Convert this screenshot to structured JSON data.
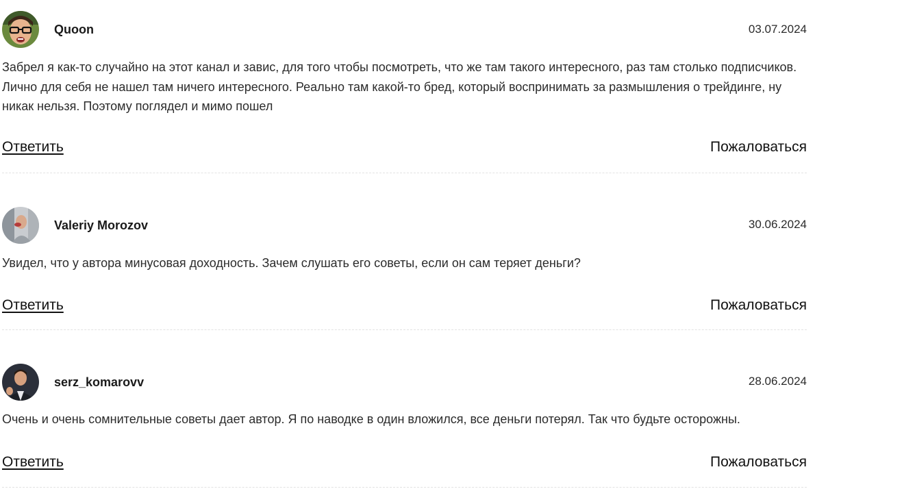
{
  "comments": [
    {
      "author": "Quoon",
      "date": "03.07.2024",
      "text": "Забрел я как-то случайно на этот канал и завис, для того чтобы посмотреть, что же там такого интересного, раз там столько подписчиков. Лично для себя не нашел там ничего интересного. Реально там какой-то бред, который воспринимать за размышления о трейдинге, ну никак нельзя. Поэтому поглядел и мимо пошел",
      "reply_label": "Ответить",
      "report_label": "Пожаловаться"
    },
    {
      "author": "Valeriy Morozov",
      "date": "30.06.2024",
      "text": "Увидел, что у автора минусовая доходность. Зачем слушать его советы, если он сам теряет деньги?",
      "reply_label": "Ответить",
      "report_label": "Пожаловаться"
    },
    {
      "author": "serz_komarovv",
      "date": "28.06.2024",
      "text": "Очень и очень сомнительные советы дает автор. Я по наводке в один вложился, все деньги потерял. Так что будьте осторожны.",
      "reply_label": "Ответить",
      "report_label": "Пожаловаться"
    }
  ]
}
